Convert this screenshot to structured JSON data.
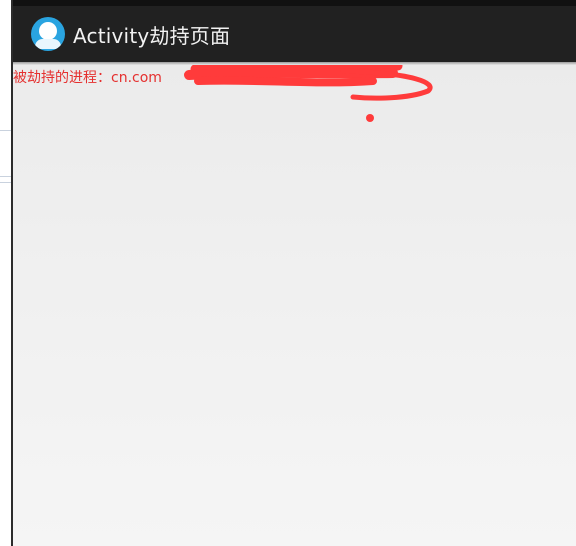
{
  "app": {
    "title": "Activity劫持页面",
    "icon": "app-logo-icon"
  },
  "content": {
    "hijacked_process_text": "被劫持的进程：cn.com"
  },
  "colors": {
    "action_bar": "#212121",
    "title_text": "#f2f2f2",
    "hijack_text": "#e5302f",
    "redaction": "#ff3b3b",
    "icon_accent": "#2aa4e0"
  }
}
